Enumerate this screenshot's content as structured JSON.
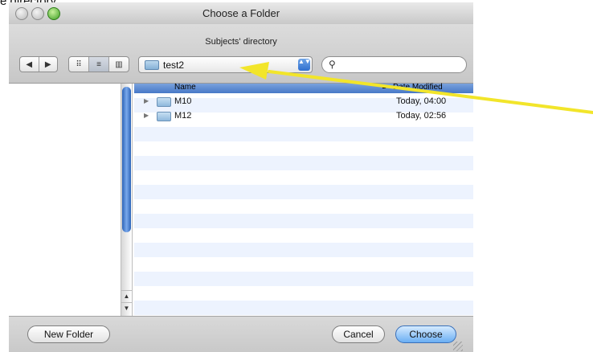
{
  "background_caption": "e  directory.",
  "window": {
    "title": "Choose a Folder",
    "subtitle": "Subjects' directory"
  },
  "toolbar": {
    "back_glyph": "◀",
    "forward_glyph": "▶",
    "view_icons_glyph": "⠿",
    "view_list_glyph": "≡",
    "view_columns_glyph": "▥",
    "location_value": "test2",
    "location_arrows": "▲▼",
    "search_glyph": "⚲",
    "search_value": ""
  },
  "list": {
    "columns": {
      "name": "Name",
      "date": "Date Modified",
      "sort_glyph": "▲"
    },
    "rows": [
      {
        "name": "M10",
        "date": "Today, 04:00",
        "expand_glyph": "▶"
      },
      {
        "name": "M12",
        "date": "Today, 02:56",
        "expand_glyph": "▶"
      }
    ]
  },
  "scrollbar": {
    "up_glyph": "▲",
    "down_glyph": "▼"
  },
  "buttons": {
    "new_folder": "New Folder",
    "cancel": "Cancel",
    "choose": "Choose"
  },
  "colors": {
    "arrow": "#f2e52a",
    "accent": "#4a7bd0"
  },
  "icons": [
    "close-icon",
    "minimize-icon",
    "zoom-icon",
    "back-icon",
    "forward-icon",
    "icon-view-icon",
    "list-view-icon",
    "column-view-icon",
    "folder-icon",
    "search-icon",
    "disclosure-triangle-icon",
    "resize-grip-icon",
    "annotation-arrow"
  ]
}
